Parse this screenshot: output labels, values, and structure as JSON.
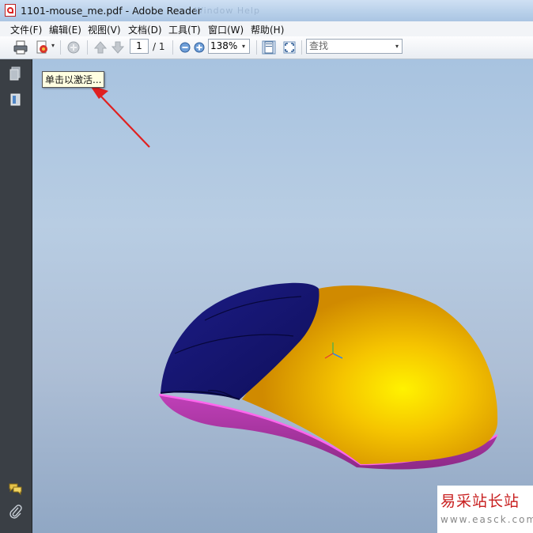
{
  "window": {
    "title": "1101-mouse_me.pdf - Adobe Reader",
    "ghost_text": "... Window  Help"
  },
  "menu": [
    "文件(F)",
    "编辑(E)",
    "视图(V)",
    "文档(D)",
    "工具(T)",
    "窗口(W)",
    "帮助(H)"
  ],
  "toolbar": {
    "page_current": "1",
    "page_total": "/ 1",
    "zoom": "138%",
    "search_placeholder": "查找"
  },
  "tooltip": "单击以激活...",
  "watermark": {
    "title": "易采站长站",
    "url": "www.easck.com"
  },
  "icons": [
    "pdf-file-icon",
    "print-icon",
    "create-pdf-icon",
    "share-icon",
    "previous-page-icon",
    "next-page-icon",
    "zoom-out-icon",
    "zoom-in-icon",
    "fit-page-icon",
    "full-screen-icon",
    "pages-panel-icon",
    "attachments-panel-icon",
    "comments-icon",
    "paperclip-icon",
    "red-arrow-annotation"
  ],
  "colors": {
    "mouse_body": "#e8a800",
    "mouse_buttons": "#1a1a78",
    "mouse_base": "#b039a8",
    "arrow": "#e02020"
  }
}
